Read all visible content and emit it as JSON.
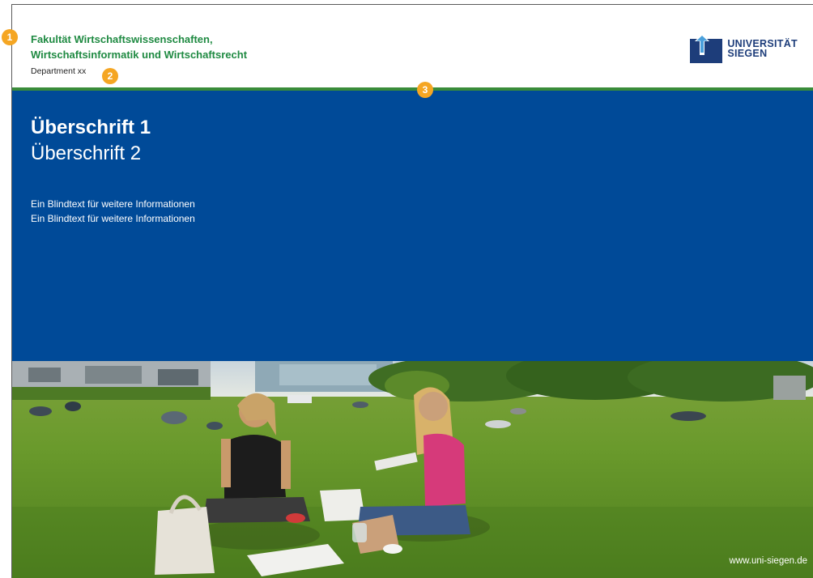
{
  "header": {
    "faculty_line1": "Fakultät Wirtschaftswissenschaften,",
    "faculty_line2": "Wirtschaftsinformatik und Wirtschaftsrecht",
    "department": "Department xx",
    "logo_line1": "UNIVERSITÄT",
    "logo_line2": "SIEGEN"
  },
  "content": {
    "heading1": "Überschrift 1",
    "heading2": "Überschrift 2",
    "blindtext": [
      "Ein Blindtext für weitere Informationen",
      "Ein Blindtext für weitere Informationen"
    ]
  },
  "footer": {
    "url": "www.uni-siegen.de"
  },
  "badges": [
    "1",
    "2",
    "3"
  ],
  "colors": {
    "faculty_green": "#1f8a42",
    "rule_green": "#3a8c3a",
    "panel_blue": "#004a98",
    "logo_blue": "#1d3d7a",
    "badge_orange": "#f5a623"
  },
  "icons": {
    "logo": "university-logo-icon",
    "photo": "students-on-lawn-photo"
  }
}
